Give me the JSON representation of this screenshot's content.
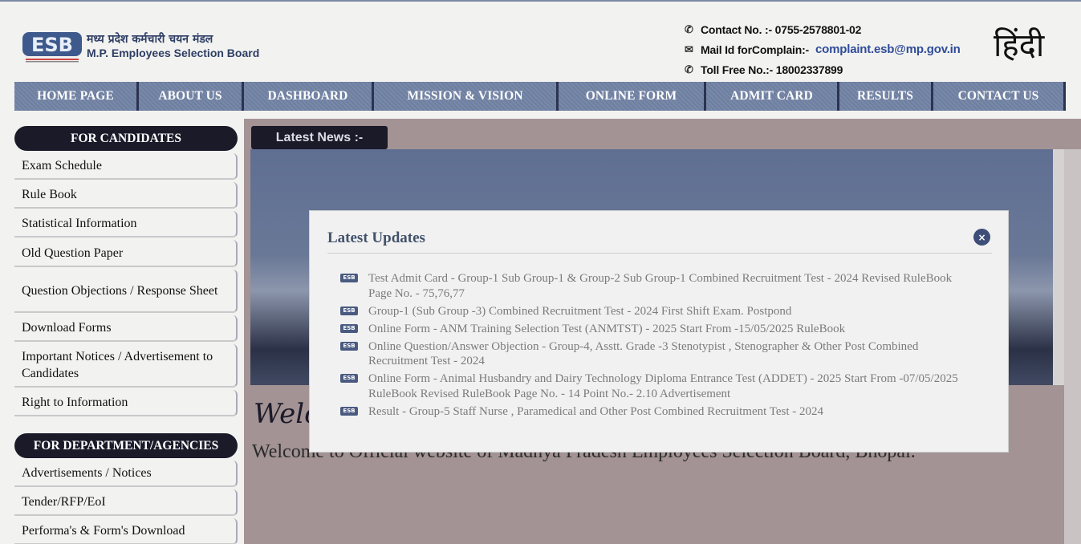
{
  "header": {
    "logo_hindi": "मध्य प्रदेश कर्मचारी चयन मंडल",
    "logo_english": "M.P. Employees Selection Board",
    "logo_mark": "ESB",
    "contact": "Contact No. :- 0755-2578801-02",
    "mail_label": "Mail Id forComplain:-",
    "mail": "complaint.esb@mp.gov.in",
    "tollfree": "Toll Free No.:- 18002337899",
    "language_button": "हिंदी"
  },
  "nav": [
    {
      "label": "HOME PAGE"
    },
    {
      "label": "ABOUT US"
    },
    {
      "label": "DASHBOARD"
    },
    {
      "label": "MISSION & VISION"
    },
    {
      "label": "ONLINE FORM"
    },
    {
      "label": "ADMIT CARD"
    },
    {
      "label": "RESULTS"
    },
    {
      "label": "CONTACT US"
    }
  ],
  "sidebar": {
    "candidates_title": "FOR CANDIDATES",
    "candidates": [
      {
        "label": "Exam Schedule"
      },
      {
        "label": "Rule Book"
      },
      {
        "label": "Statistical Information"
      },
      {
        "label": "Old Question Paper"
      },
      {
        "label": "Question Objections / Response Sheet"
      },
      {
        "label": "Download Forms"
      },
      {
        "label": "Important Notices / Advertisement to Candidates"
      },
      {
        "label": "Right to Information"
      }
    ],
    "department_title": "FOR DEPARTMENT/AGENCIES",
    "department": [
      {
        "label": "Advertisements / Notices"
      },
      {
        "label": "Tender/RFP/EoI"
      },
      {
        "label": "Performa's & Form's Download"
      }
    ]
  },
  "main": {
    "news_label": "Latest News :-",
    "welcome_script": "Welc",
    "welcome_text": "Welcome to Official website of Madhya Pradesh Employees Selection Board, Bhopal."
  },
  "modal": {
    "title": "Latest Updates",
    "close_glyph": "×",
    "badge": "ESB",
    "updates": [
      {
        "text": "Test Admit Card - Group-1 Sub Group-1 & Group-2 Sub Group-1 Combined Recruitment Test - 2024    Revised RuleBook Page No. - 75,76,77"
      },
      {
        "text": "Group-1 (Sub Group -3) Combined Recruitment Test - 2024 First Shift Exam. Postpond"
      },
      {
        "text": "Online Form - ANM Training Selection Test (ANMTST) - 2025 Start From -15/05/2025 RuleBook"
      },
      {
        "text": "Online Question/Answer Objection - Group-4, Asstt. Grade -3 Stenotypist , Stenographer & Other Post Combined Recruitment Test - 2024"
      },
      {
        "text": "Online Form - Animal Husbandry and Dairy Technology Diploma Entrance Test (ADDET) - 2025 Start From -07/05/2025 RuleBook   Revised RuleBook Page No. - 14 Point No.- 2.10   Advertisement"
      },
      {
        "text": "Result - Group-5 Staff Nurse , Paramedical and Other Post Combined Recruitment Test - 2024"
      }
    ]
  }
}
